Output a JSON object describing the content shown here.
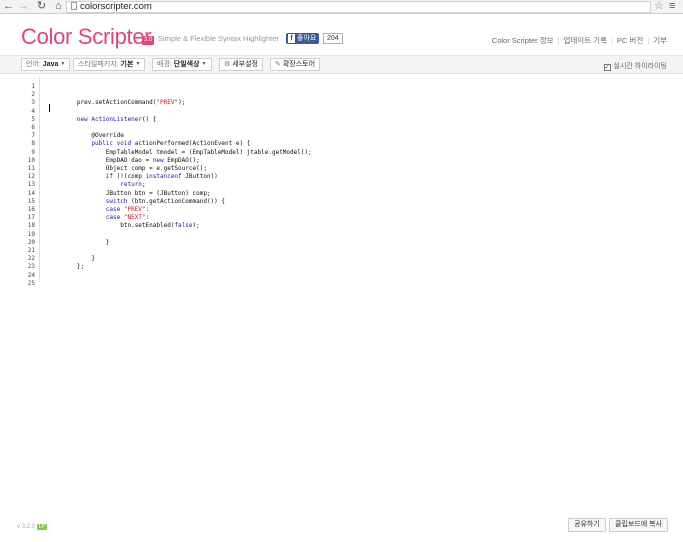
{
  "browser": {
    "url": "colorscripter.com"
  },
  "header": {
    "logo": "Color Scripter",
    "version_badge": "3.0",
    "tagline": "Simple & Flexible Syntax Highlighter",
    "fb_like_label": "좋아요",
    "fb_count": "204",
    "links": [
      "Color Scripter 정보",
      "업데이트 기록",
      "PC 버전",
      "기부"
    ]
  },
  "toolbar": {
    "language_label": "언어:",
    "language_value": "Java",
    "style_label": "스타일패키지:",
    "style_value": "기본",
    "background_label": "배경:",
    "background_value": "단일색상",
    "settings_label": "세부설정",
    "extension_label": "확장스토어",
    "realtime_label": "실시간 하이라이팅",
    "realtime_checked": true
  },
  "editor": {
    "line_numbers": [
      "1",
      "2",
      "3",
      "4",
      "5",
      "6",
      "7",
      "8",
      "9",
      "10",
      "11",
      "12",
      "13",
      "14",
      "15",
      "16",
      "17",
      "18",
      "19",
      "20",
      "21",
      "22",
      "23",
      "24",
      "25"
    ],
    "lines": [
      "",
      "",
      "        prev.setActionCommand(\"PREV\");",
      "",
      "        new ActionListener() {",
      "",
      "            @Override",
      "            public void actionPerformed(ActionEvent e) {",
      "                EmpTableModel tmodel = (EmpTableModel) jtable.getModel();",
      "                EmpDAO dao = new EmpDAO();",
      "                Object comp = e.getSource();",
      "                if (!(comp instanceof JButton))",
      "                    return;",
      "                JButton btn = (JButton) comp;",
      "                switch (btn.getActionCommand()) {",
      "                case \"PREV\":",
      "                case \"NEXT\":",
      "                    btn.setEnabled(false);",
      "",
      "                }",
      "",
      "            }",
      "        };",
      "",
      ""
    ]
  },
  "footer": {
    "version": "v 3.2.0",
    "version_badge": "LP",
    "share_label": "공유하기",
    "copy_label": "클립보드에 복사"
  }
}
